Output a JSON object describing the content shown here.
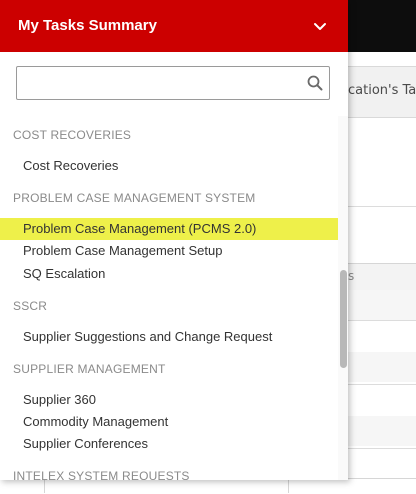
{
  "background": {
    "tab_label": "cation's Ta",
    "column_header_fragment": "s"
  },
  "dropdown": {
    "title": "My Tasks Summary",
    "chevron_icon": "chevron-down-icon",
    "header_color": "#cc0000",
    "highlight_color": "#eef04a"
  },
  "search": {
    "value": "",
    "placeholder": "",
    "icon": "search-icon"
  },
  "groups": [
    {
      "header": "COST RECOVERIES",
      "items": [
        {
          "label": "Cost Recoveries"
        }
      ]
    },
    {
      "header": "PROBLEM CASE MANAGEMENT SYSTEM",
      "items": [
        {
          "label": "Problem Case Management (PCMS 2.0)",
          "highlighted": true
        },
        {
          "label": "Problem Case Management Setup"
        },
        {
          "label": "SQ Escalation"
        }
      ]
    },
    {
      "header": "SSCR",
      "items": [
        {
          "label": "Supplier Suggestions and Change Request"
        }
      ]
    },
    {
      "header": "SUPPLIER MANAGEMENT",
      "items": [
        {
          "label": "Supplier 360"
        },
        {
          "label": "Commodity Management"
        },
        {
          "label": "Supplier Conferences"
        }
      ]
    },
    {
      "header": "INTELEX SYSTEM REQUESTS",
      "items": []
    }
  ]
}
